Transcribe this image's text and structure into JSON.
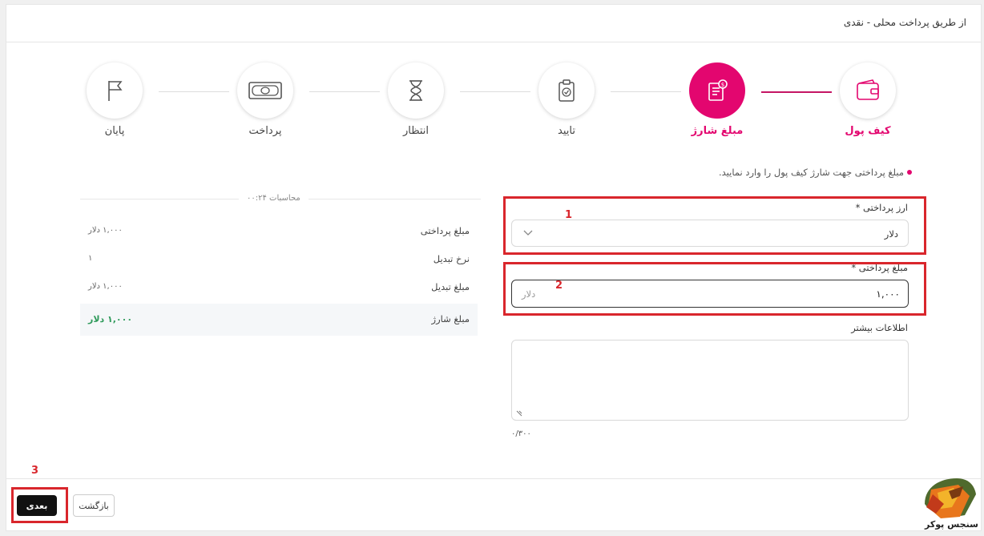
{
  "header": {
    "title": "از طریق پرداخت محلی - نقدی"
  },
  "stepper": {
    "steps": [
      {
        "label": "کیف پول",
        "icon": "wallet-icon"
      },
      {
        "label": "مبلغ شارژ",
        "icon": "invoice-icon"
      },
      {
        "label": "تایید",
        "icon": "clipboard-check-icon"
      },
      {
        "label": "انتظار",
        "icon": "hourglass-icon"
      },
      {
        "label": "پرداخت",
        "icon": "banknote-icon"
      },
      {
        "label": "پایان",
        "icon": "flag-icon"
      }
    ],
    "active_color": "#e3066f"
  },
  "hint": "مبلغ پرداختی جهت شارژ کیف پول را وارد نمایید.",
  "calculation": {
    "title": "محاسبات ۰۰:۲۴",
    "rows": [
      {
        "label": "مبلغ پرداختی",
        "value": "۱,۰۰۰ دلار"
      },
      {
        "label": "نرخ تبدیل",
        "value": "۱"
      },
      {
        "label": "مبلغ تبدیل",
        "value": "۱,۰۰۰ دلار"
      },
      {
        "label": "مبلغ شارژ",
        "value": "۱,۰۰۰ دلار"
      }
    ]
  },
  "form": {
    "currency": {
      "label": "ارز پرداختی *",
      "value": "دلار"
    },
    "amount": {
      "label": "مبلغ پرداختی *",
      "value": "۱,۰۰۰",
      "unit": "دلار"
    },
    "notes": {
      "label": "اطلاعات بیشتر",
      "value": "",
      "counter": "۰/۳۰۰"
    }
  },
  "annotations": [
    "1",
    "2",
    "3"
  ],
  "footer": {
    "next_label": "بعدی",
    "back_label": "بازگشت"
  },
  "brand": {
    "name": "سنجس پوکر"
  }
}
